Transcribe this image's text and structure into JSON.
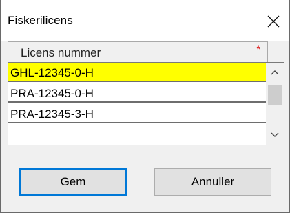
{
  "window": {
    "title": "Fiskerilicens",
    "close_icon": "close-icon"
  },
  "field": {
    "label": "Licens nummer",
    "required_marker": "*"
  },
  "list": {
    "items": [
      {
        "label": "GHL-12345-0-H",
        "selected": true
      },
      {
        "label": "PRA-12345-0-H",
        "selected": false
      },
      {
        "label": "PRA-12345-3-H",
        "selected": false
      },
      {
        "label": "",
        "selected": false
      }
    ],
    "selected_color": "#ffff00"
  },
  "buttons": {
    "save_label": "Gem",
    "cancel_label": "Annuller",
    "accent": "#0078d7"
  }
}
